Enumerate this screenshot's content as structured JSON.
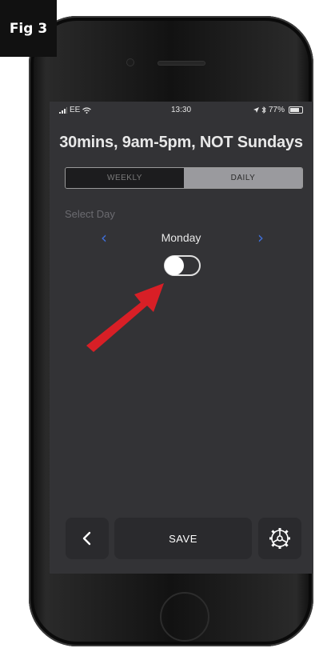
{
  "figure_label": "Fig 3",
  "status_bar": {
    "carrier": "EE",
    "time": "13:30",
    "battery_percent": "77%"
  },
  "schedule": {
    "title": "30mins, 9am-5pm, NOT Sundays"
  },
  "mode_tabs": {
    "weekly": "WEEKLY",
    "daily": "DAILY",
    "selected": "DAILY"
  },
  "day_selector": {
    "label": "Select Day",
    "day": "Monday",
    "enabled": false
  },
  "footer": {
    "save_label": "SAVE"
  },
  "icons": {
    "back": "chevron-left-icon",
    "settings": "gear-icon",
    "annotation": "red-arrow"
  },
  "colors": {
    "accent_blue": "#3f6fd8",
    "annotation_red": "#d81f26",
    "screen_bg": "#333336"
  }
}
